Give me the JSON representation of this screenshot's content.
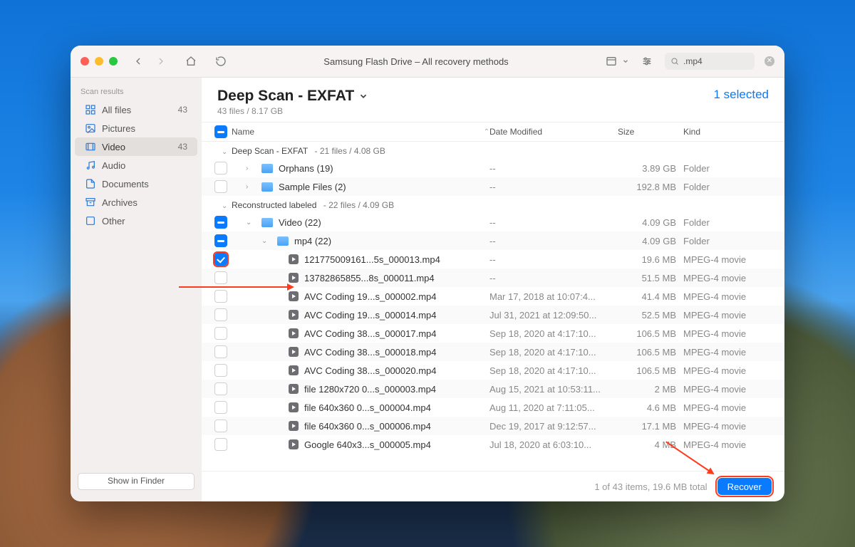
{
  "toolbar": {
    "title": "Samsung Flash Drive – All recovery methods",
    "search_value": ".mp4"
  },
  "sidebar": {
    "section": "Scan results",
    "items": [
      {
        "label": "All files",
        "count": "43"
      },
      {
        "label": "Pictures",
        "count": ""
      },
      {
        "label": "Video",
        "count": "43"
      },
      {
        "label": "Audio",
        "count": ""
      },
      {
        "label": "Documents",
        "count": ""
      },
      {
        "label": "Archives",
        "count": ""
      },
      {
        "label": "Other",
        "count": ""
      }
    ],
    "finder_button": "Show in Finder"
  },
  "header": {
    "title": "Deep Scan - EXFAT",
    "subtitle": "43 files / 8.17 GB",
    "selected": "1 selected"
  },
  "columns": {
    "name": "Name",
    "date": "Date Modified",
    "size": "Size",
    "kind": "Kind"
  },
  "groups": [
    {
      "label": "Deep Scan - EXFAT",
      "meta": "21 files / 4.08 GB"
    },
    {
      "label": "Reconstructed labeled",
      "meta": "22 files / 4.09 GB"
    }
  ],
  "folders": {
    "orphans": {
      "name": "Orphans (19)",
      "date": "--",
      "size": "3.89 GB",
      "kind": "Folder"
    },
    "sample": {
      "name": "Sample Files (2)",
      "date": "--",
      "size": "192.8 MB",
      "kind": "Folder"
    },
    "video": {
      "name": "Video (22)",
      "date": "--",
      "size": "4.09 GB",
      "kind": "Folder"
    },
    "mp4": {
      "name": "mp4 (22)",
      "date": "--",
      "size": "4.09 GB",
      "kind": "Folder"
    }
  },
  "files": [
    {
      "name": "121775009161...5s_000013.mp4",
      "date": "--",
      "size": "19.6 MB",
      "kind": "MPEG-4 movie"
    },
    {
      "name": "13782865855...8s_000011.mp4",
      "date": "--",
      "size": "51.5 MB",
      "kind": "MPEG-4 movie"
    },
    {
      "name": "AVC Coding 19...s_000002.mp4",
      "date": "Mar 17, 2018 at 10:07:4...",
      "size": "41.4 MB",
      "kind": "MPEG-4 movie"
    },
    {
      "name": "AVC Coding 19...s_000014.mp4",
      "date": "Jul 31, 2021 at 12:09:50...",
      "size": "52.5 MB",
      "kind": "MPEG-4 movie"
    },
    {
      "name": "AVC Coding 38...s_000017.mp4",
      "date": "Sep 18, 2020 at 4:17:10...",
      "size": "106.5 MB",
      "kind": "MPEG-4 movie"
    },
    {
      "name": "AVC Coding 38...s_000018.mp4",
      "date": "Sep 18, 2020 at 4:17:10...",
      "size": "106.5 MB",
      "kind": "MPEG-4 movie"
    },
    {
      "name": "AVC Coding 38...s_000020.mp4",
      "date": "Sep 18, 2020 at 4:17:10...",
      "size": "106.5 MB",
      "kind": "MPEG-4 movie"
    },
    {
      "name": "file 1280x720 0...s_000003.mp4",
      "date": "Aug 15, 2021 at 10:53:11...",
      "size": "2 MB",
      "kind": "MPEG-4 movie"
    },
    {
      "name": "file 640x360 0...s_000004.mp4",
      "date": "Aug 11, 2020 at 7:11:05...",
      "size": "4.6 MB",
      "kind": "MPEG-4 movie"
    },
    {
      "name": "file 640x360 0...s_000006.mp4",
      "date": "Dec 19, 2017 at 9:12:57...",
      "size": "17.1 MB",
      "kind": "MPEG-4 movie"
    },
    {
      "name": "Google 640x3...s_000005.mp4",
      "date": "Jul 18, 2020 at 6:03:10...",
      "size": "4 MB",
      "kind": "MPEG-4 movie"
    }
  ],
  "footer": {
    "status": "1 of 43 items, 19.6 MB total",
    "recover": "Recover"
  }
}
